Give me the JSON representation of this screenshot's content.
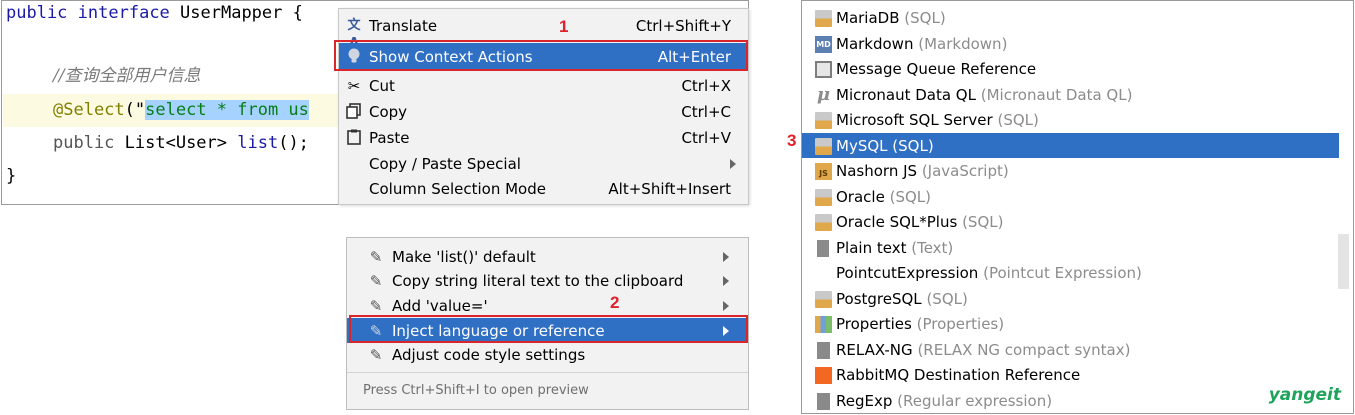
{
  "editor": {
    "line1_kw1": "public",
    "line1_kw2": "interface",
    "line1_name": " UserMapper {",
    "comment": "//查询全部用户信息",
    "annotation": "@Select",
    "paren_open": "(\"",
    "selected_text": "select * from us",
    "line4_kw": "public",
    "line4_rest": " List<User> ",
    "line4_method": "list",
    "line4_end": "();",
    "closing": "}"
  },
  "context_menu": {
    "items": [
      {
        "label": "Translate",
        "shortcut": "Ctrl+Shift+Y",
        "icon": "translate-icon"
      },
      {
        "label": "Show Context Actions",
        "shortcut": "Alt+Enter",
        "icon": "bulb-icon"
      },
      {
        "label": "Cut",
        "shortcut": "Ctrl+X",
        "icon": "scissors-icon"
      },
      {
        "label": "Copy",
        "shortcut": "Ctrl+C",
        "icon": "copy-icon"
      },
      {
        "label": "Paste",
        "shortcut": "Ctrl+V",
        "icon": "paste-icon"
      },
      {
        "label": "Copy / Paste Special",
        "shortcut": "",
        "icon": ""
      },
      {
        "label": "Column Selection Mode",
        "shortcut": "Alt+Shift+Insert",
        "icon": ""
      }
    ],
    "step_label": "1"
  },
  "intent_menu": {
    "items": [
      {
        "label": "Make 'list()' default"
      },
      {
        "label": "Copy string literal text to the clipboard"
      },
      {
        "label": "Add 'value='"
      },
      {
        "label": "Inject language or reference"
      },
      {
        "label": "Adjust code style settings"
      }
    ],
    "footer": "Press Ctrl+Shift+I to open preview",
    "step_label": "2"
  },
  "language_list": {
    "items": [
      {
        "name": "MariaDB",
        "hint": "(SQL)",
        "icon": "sql-icon"
      },
      {
        "name": "Markdown",
        "hint": "(Markdown)",
        "icon": "markdown-icon"
      },
      {
        "name": "Message Queue Reference",
        "hint": "",
        "icon": "envelope-icon"
      },
      {
        "name": "Micronaut Data QL",
        "hint": "(Micronaut Data QL)",
        "icon": "micronaut-icon"
      },
      {
        "name": "Microsoft SQL Server",
        "hint": "(SQL)",
        "icon": "sql-icon"
      },
      {
        "name": "MySQL",
        "hint": "(SQL)",
        "icon": "sql-icon"
      },
      {
        "name": "Nashorn JS",
        "hint": "(JavaScript)",
        "icon": "js-icon"
      },
      {
        "name": "Oracle",
        "hint": "(SQL)",
        "icon": "sql-icon"
      },
      {
        "name": "Oracle SQL*Plus",
        "hint": "(SQL)",
        "icon": "sql-icon"
      },
      {
        "name": "Plain text",
        "hint": "(Text)",
        "icon": "text-file-icon"
      },
      {
        "name": "PointcutExpression",
        "hint": "(Pointcut Expression)",
        "icon": ""
      },
      {
        "name": "PostgreSQL",
        "hint": "(SQL)",
        "icon": "sql-icon"
      },
      {
        "name": "Properties",
        "hint": "(Properties)",
        "icon": "properties-icon"
      },
      {
        "name": "RELAX-NG",
        "hint": "(RELAX NG compact syntax)",
        "icon": "relax-ng-icon"
      },
      {
        "name": "RabbitMQ Destination Reference",
        "hint": "",
        "icon": "rabbitmq-icon"
      },
      {
        "name": "RegExp",
        "hint": "(Regular expression)",
        "icon": "regexp-icon"
      }
    ],
    "step_label": "3",
    "watermark": "yangeit"
  },
  "colors": {
    "selection_blue": "#2f6fc4",
    "annotation_red": "#d9252b",
    "keyword": "#1a1aa6",
    "string_green": "#067d17",
    "watermark_green": "#1fa35a"
  }
}
